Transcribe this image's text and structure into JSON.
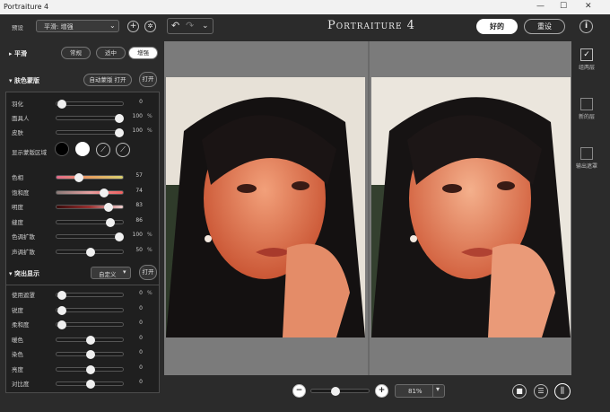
{
  "window": {
    "title": "Portraiture 4"
  },
  "toolbar": {
    "preset_label": "预设",
    "preset_value": "平滑: 增强",
    "logo": "Portraiture 4",
    "ok": "好的",
    "reset": "重设"
  },
  "smooth": {
    "title": "平滑",
    "opts": [
      "常规",
      "适中",
      "增强"
    ],
    "selected": "增强"
  },
  "skin": {
    "title": "肤色蒙版",
    "auto": "自动蒙版 打开",
    "toggle": "打开",
    "sliders": [
      {
        "label": "羽化",
        "value": "0",
        "unit": "",
        "pos": 0.02,
        "style": "plain"
      },
      {
        "label": "面具人",
        "value": "100",
        "unit": "%",
        "pos": 0.98,
        "style": "plain"
      },
      {
        "label": "皮肤",
        "value": "100",
        "unit": "%",
        "pos": 0.98,
        "style": "plain"
      }
    ],
    "show_area": "显示蒙版区域",
    "color_sliders": [
      {
        "label": "色相",
        "value": "57",
        "unit": "",
        "pos": 0.3,
        "style": "hue"
      },
      {
        "label": "饱和度",
        "value": "74",
        "unit": "",
        "pos": 0.72,
        "style": "sat"
      },
      {
        "label": "明度",
        "value": "83",
        "unit": "",
        "pos": 0.81,
        "style": "lum"
      },
      {
        "label": "缝度",
        "value": "86",
        "unit": "",
        "pos": 0.84,
        "style": "plain"
      },
      {
        "label": "色调扩散",
        "value": "100",
        "unit": "%",
        "pos": 0.98,
        "style": "plain"
      },
      {
        "label": "声调扩散",
        "value": "50",
        "unit": "%",
        "pos": 0.5,
        "style": "plain"
      }
    ]
  },
  "enhance": {
    "title": "突出显示",
    "preset": "自定义",
    "toggle": "打开",
    "sliders": [
      {
        "label": "使用遮罩",
        "value": "0",
        "unit": "%",
        "pos": 0.02
      },
      {
        "label": "锐度",
        "value": "0",
        "unit": "",
        "pos": 0.02
      },
      {
        "label": "柔和度",
        "value": "0",
        "unit": "",
        "pos": 0.02
      },
      {
        "label": "暖色",
        "value": "0",
        "unit": "",
        "pos": 0.5
      },
      {
        "label": "染色",
        "value": "0",
        "unit": "",
        "pos": 0.5
      },
      {
        "label": "亮度",
        "value": "0",
        "unit": "",
        "pos": 0.5
      },
      {
        "label": "对比度",
        "value": "0",
        "unit": "",
        "pos": 0.5
      }
    ]
  },
  "zoom": {
    "value": "81%",
    "slider_pos": 0.4
  },
  "right": {
    "items": [
      {
        "label": "组两层",
        "checked": true
      },
      {
        "label": "新的层",
        "checked": false
      },
      {
        "label": "输出遮罩",
        "checked": false
      }
    ]
  },
  "colors": {
    "accent": "#ffffff",
    "panel": "#1f1f1f",
    "canvas": "#7b7b7b"
  }
}
